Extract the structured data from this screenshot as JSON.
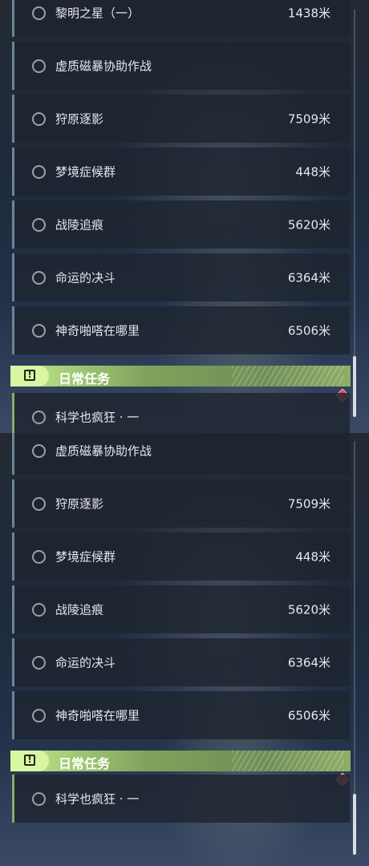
{
  "panel1": {
    "quests": [
      {
        "name": "黎明之星（一）",
        "distance": "1438米"
      },
      {
        "name": "虚质磁暴协助作战",
        "distance": ""
      },
      {
        "name": "狩原逐影",
        "distance": "7509米"
      },
      {
        "name": "梦境症候群",
        "distance": "448米"
      },
      {
        "name": "战陵追痕",
        "distance": "5620米"
      },
      {
        "name": "命运的决斗",
        "distance": "6364米"
      },
      {
        "name": "神奇啪嗒在哪里",
        "distance": "6506米"
      }
    ],
    "daily_header": {
      "icon": "!",
      "title": "日常任务"
    },
    "daily_quest": {
      "name": "科学也疯狂 · 一"
    }
  },
  "panel2": {
    "quests": [
      {
        "name": "虚质磁暴协助作战",
        "distance": ""
      },
      {
        "name": "狩原逐影",
        "distance": "7509米"
      },
      {
        "name": "梦境症候群",
        "distance": "448米"
      },
      {
        "name": "战陵追痕",
        "distance": "5620米"
      },
      {
        "name": "命运的决斗",
        "distance": "6364米"
      },
      {
        "name": "神奇啪嗒在哪里",
        "distance": "6506米"
      }
    ],
    "daily_header": {
      "icon": "!",
      "title": "日常任务"
    },
    "daily_quest": {
      "name": "科学也疯狂 · 一"
    }
  },
  "colors": {
    "daily_accent": "#c6ec8c",
    "alert_diamond": "#e0465c",
    "quest_bar": "#6e8496"
  }
}
